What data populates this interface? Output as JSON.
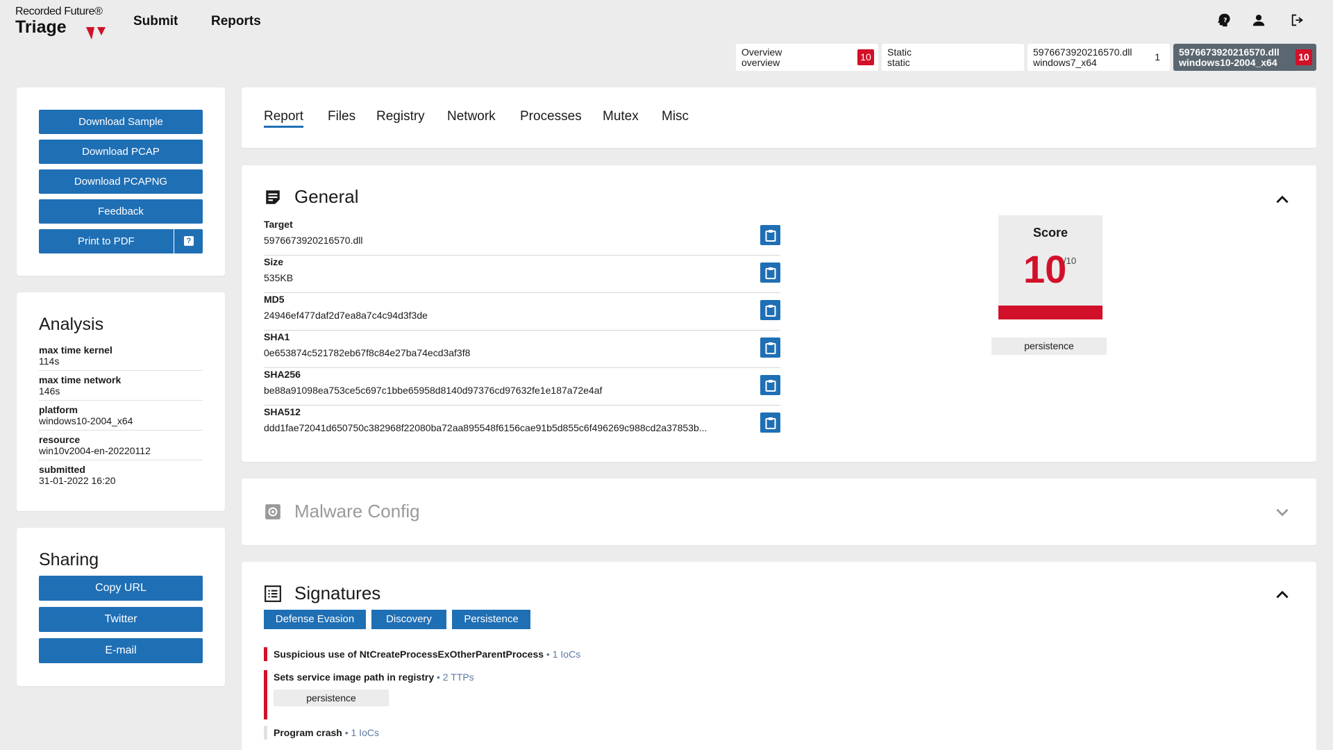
{
  "header": {
    "brand_top": "Recorded Future®",
    "brand_bottom": "Triage",
    "nav": [
      {
        "label": "Submit"
      },
      {
        "label": "Reports"
      }
    ],
    "icons": [
      "help-icon",
      "user-icon",
      "logout-icon"
    ]
  },
  "report_tabs": [
    {
      "line1": "Overview",
      "line2": "overview",
      "badge": "10"
    },
    {
      "line1": "Static",
      "line2": "static"
    },
    {
      "line1": "5976673920216570.dll",
      "line2": "windows7_x64",
      "count": "1"
    },
    {
      "line1": "5976673920216570.dll",
      "line2": "windows10-2004_x64",
      "badge": "10",
      "active": true
    }
  ],
  "actions": {
    "download_sample": "Download Sample",
    "download_pcap": "Download PCAP",
    "download_pcapng": "Download PCAPNG",
    "feedback": "Feedback",
    "print_pdf": "Print to PDF",
    "print_pdf_help": "?"
  },
  "analysis": {
    "title": "Analysis",
    "rows": [
      {
        "key": "max time kernel",
        "value": "114s"
      },
      {
        "key": "max time network",
        "value": "146s"
      },
      {
        "key": "platform",
        "value": "windows10-2004_x64"
      },
      {
        "key": "resource",
        "value": "win10v2004-en-20220112"
      },
      {
        "key": "submitted",
        "value": "31-01-2022 16:20"
      }
    ]
  },
  "sharing": {
    "title": "Sharing",
    "copy_url": "Copy URL",
    "twitter": "Twitter",
    "email": "E-mail"
  },
  "main_tabs": [
    "Report",
    "Files",
    "Registry",
    "Network",
    "Processes",
    "Mutex",
    "Misc"
  ],
  "general": {
    "title": "General",
    "fields": [
      {
        "key": "Target",
        "value": "5976673920216570.dll"
      },
      {
        "key": "Size",
        "value": "535KB"
      },
      {
        "key": "MD5",
        "value": "24946ef477daf2d7ea8a7c4c94d3f3de"
      },
      {
        "key": "SHA1",
        "value": "0e653874c521782eb67f8c84e27ba74ecd3af3f8"
      },
      {
        "key": "SHA256",
        "value": "be88a91098ea753ce5c697c1bbe65958d8140d97376cd97632fe1e187a72e4af"
      },
      {
        "key": "SHA512",
        "value": "ddd1fae72041d650750c382968f22080ba72aa895548f6156cae91b5d855c6f496269c988cd2a37853b..."
      }
    ],
    "score_label": "Score",
    "score": "10",
    "score_max": "/10",
    "score_level": 1.0,
    "score_tag": "persistence"
  },
  "malware_config": {
    "title": "Malware Config"
  },
  "signatures": {
    "title": "Signatures",
    "tags": [
      "Defense Evasion",
      "Discovery",
      "Persistence"
    ],
    "items": [
      {
        "text": "Suspicious use of NtCreateProcessExOtherParentProcess",
        "meta": " • 1 IoCs",
        "severity": "high"
      },
      {
        "text": "Sets service image path in registry",
        "meta": " • 2 TTPs",
        "severity": "high",
        "tag": "persistence"
      },
      {
        "text": "Program crash",
        "meta": " • 1 IoCs",
        "severity": "low"
      }
    ]
  },
  "colors": {
    "accent": "#1f6fb5",
    "danger": "#d2102a",
    "background": "#ececec"
  }
}
